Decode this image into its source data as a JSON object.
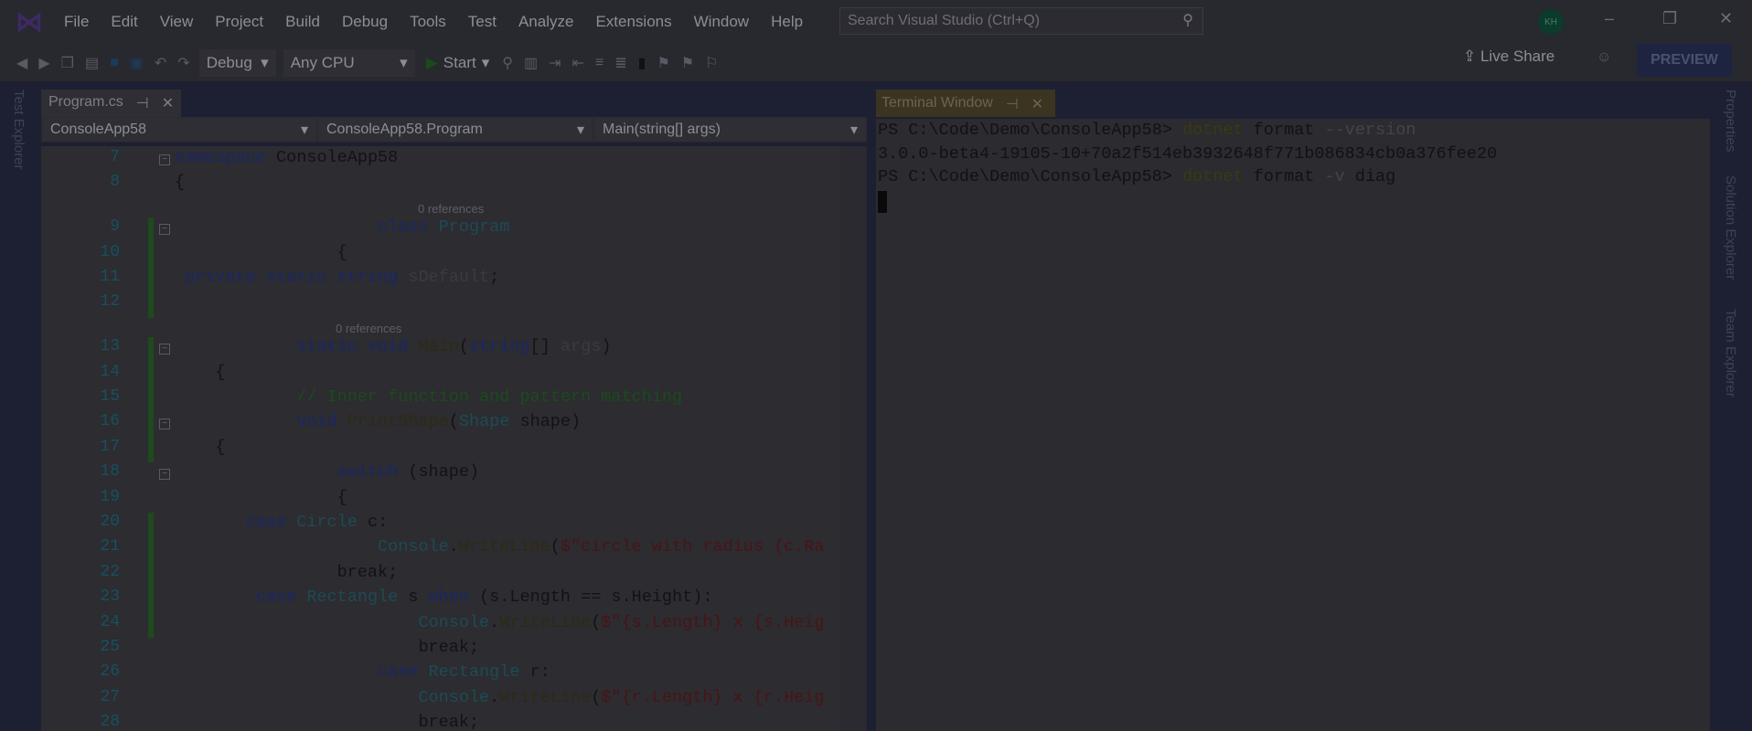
{
  "menu": [
    "File",
    "Edit",
    "View",
    "Project",
    "Build",
    "Debug",
    "Tools",
    "Test",
    "Analyze",
    "Extensions",
    "Window",
    "Help"
  ],
  "search": {
    "placeholder": "Search Visual Studio (Ctrl+Q)"
  },
  "user": {
    "initials": "KH"
  },
  "toolbar": {
    "config": "Debug",
    "platform": "Any CPU",
    "start": "Start",
    "live_share": "Live Share",
    "preview": "PREVIEW"
  },
  "side": {
    "left": "Test Explorer",
    "right": [
      "Properties",
      "Solution Explorer",
      "Team Explorer"
    ]
  },
  "editor": {
    "tab": "Program.cs",
    "nav": [
      "ConsoleApp58",
      "ConsoleApp58.Program",
      "Main(string[] args)"
    ],
    "lens": "0 references",
    "lines": [
      {
        "n": "7",
        "t": [
          [
            "namespace ",
            "kw"
          ],
          [
            "ConsoleApp58",
            ""
          ]
        ]
      },
      {
        "n": "8",
        "t": [
          [
            "{",
            ""
          ]
        ]
      },
      {
        "n": "9",
        "t": [
          [
            "                    class ",
            "kw"
          ],
          [
            "Program",
            "ty"
          ]
        ]
      },
      {
        "n": "10",
        "t": [
          [
            "                {",
            ""
          ]
        ]
      },
      {
        "n": "11",
        "t": [
          [
            " private static string ",
            "kw"
          ],
          [
            "sDefault",
            "id"
          ],
          [
            ";",
            ""
          ]
        ]
      },
      {
        "n": "12",
        "t": []
      },
      {
        "n": "13",
        "t": [
          [
            "            static void ",
            "kw"
          ],
          [
            "Main",
            "mt"
          ],
          [
            "(",
            ""
          ],
          [
            "string",
            "kw"
          ],
          [
            "[] ",
            ""
          ],
          [
            "args",
            "id"
          ],
          [
            ")",
            ""
          ]
        ]
      },
      {
        "n": "14",
        "t": [
          [
            "    {",
            ""
          ]
        ]
      },
      {
        "n": "15",
        "t": [
          [
            "            // Inner function and pattern matching",
            "cm"
          ]
        ]
      },
      {
        "n": "16",
        "t": [
          [
            "            void ",
            "kw"
          ],
          [
            "PrintShape",
            "mt"
          ],
          [
            "(",
            ""
          ],
          [
            "Shape",
            "ty"
          ],
          [
            " shape)",
            ""
          ]
        ]
      },
      {
        "n": "17",
        "t": [
          [
            "    {",
            ""
          ]
        ]
      },
      {
        "n": "18",
        "t": [
          [
            "                switch ",
            "kw"
          ],
          [
            "(shape)",
            ""
          ]
        ]
      },
      {
        "n": "19",
        "t": [
          [
            "                {",
            ""
          ]
        ]
      },
      {
        "n": "20",
        "t": [
          [
            "       case ",
            "kw"
          ],
          [
            "Circle",
            "ty"
          ],
          [
            " c:",
            ""
          ]
        ]
      },
      {
        "n": "21",
        "t": [
          [
            "                    Console",
            "ty"
          ],
          [
            ".",
            ""
          ],
          [
            "WriteLine",
            "mt"
          ],
          [
            "(",
            ""
          ],
          [
            "$\"circle with radius {c.Ra",
            "st"
          ]
        ]
      },
      {
        "n": "22",
        "t": [
          [
            "                break",
            ""
          ],
          [
            ";",
            ""
          ]
        ]
      },
      {
        "n": "23",
        "t": [
          [
            "        case ",
            "kw"
          ],
          [
            "Rectangle",
            "ty"
          ],
          [
            " s ",
            ""
          ],
          [
            "when ",
            "kw"
          ],
          [
            "(s.Length == s.Height):",
            ""
          ]
        ]
      },
      {
        "n": "24",
        "t": [
          [
            "                        Console",
            "ty"
          ],
          [
            ".",
            ""
          ],
          [
            "WriteLine",
            "mt"
          ],
          [
            "(",
            ""
          ],
          [
            "$\"{s.Length} x {s.Heig",
            "st"
          ]
        ]
      },
      {
        "n": "25",
        "t": [
          [
            "                        break;",
            ""
          ]
        ]
      },
      {
        "n": "26",
        "t": [
          [
            "                    case ",
            "kw"
          ],
          [
            "Rectangle",
            "ty"
          ],
          [
            " r:",
            ""
          ]
        ]
      },
      {
        "n": "27",
        "t": [
          [
            "                        Console",
            "ty"
          ],
          [
            ".",
            ""
          ],
          [
            "WriteLine",
            "mt"
          ],
          [
            "(",
            ""
          ],
          [
            "$\"{r.Length} x {r.Heig",
            "st"
          ]
        ]
      },
      {
        "n": "28",
        "t": [
          [
            "                        break;",
            ""
          ]
        ]
      }
    ]
  },
  "terminal": {
    "tab": "Terminal Window",
    "prompt": "PS C:\\Code\\Demo\\ConsoleApp58> ",
    "cmd1": {
      "exe": "dotnet",
      "a": " format ",
      "b": "--version"
    },
    "output": "3.0.0-beta4-19105-10+70a2f514eb3932648f771b086834cb0a376fee20",
    "cmd2": {
      "exe": "dotnet",
      "a": " format ",
      "b": "-v",
      "c": " diag"
    }
  }
}
